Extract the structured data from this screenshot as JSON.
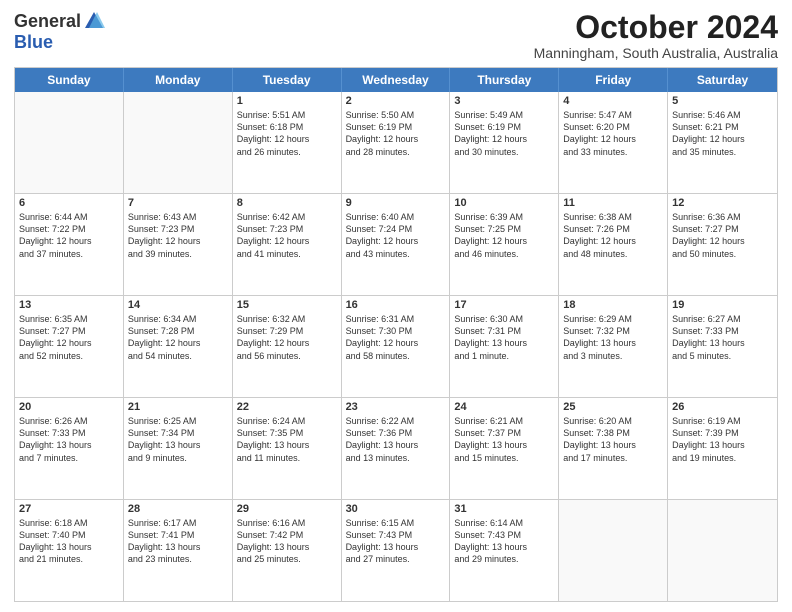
{
  "logo": {
    "general": "General",
    "blue": "Blue"
  },
  "title": "October 2024",
  "subtitle": "Manningham, South Australia, Australia",
  "headers": [
    "Sunday",
    "Monday",
    "Tuesday",
    "Wednesday",
    "Thursday",
    "Friday",
    "Saturday"
  ],
  "weeks": [
    [
      {
        "day": "",
        "text": ""
      },
      {
        "day": "",
        "text": ""
      },
      {
        "day": "1",
        "text": "Sunrise: 5:51 AM\nSunset: 6:18 PM\nDaylight: 12 hours\nand 26 minutes."
      },
      {
        "day": "2",
        "text": "Sunrise: 5:50 AM\nSunset: 6:19 PM\nDaylight: 12 hours\nand 28 minutes."
      },
      {
        "day": "3",
        "text": "Sunrise: 5:49 AM\nSunset: 6:19 PM\nDaylight: 12 hours\nand 30 minutes."
      },
      {
        "day": "4",
        "text": "Sunrise: 5:47 AM\nSunset: 6:20 PM\nDaylight: 12 hours\nand 33 minutes."
      },
      {
        "day": "5",
        "text": "Sunrise: 5:46 AM\nSunset: 6:21 PM\nDaylight: 12 hours\nand 35 minutes."
      }
    ],
    [
      {
        "day": "6",
        "text": "Sunrise: 6:44 AM\nSunset: 7:22 PM\nDaylight: 12 hours\nand 37 minutes."
      },
      {
        "day": "7",
        "text": "Sunrise: 6:43 AM\nSunset: 7:23 PM\nDaylight: 12 hours\nand 39 minutes."
      },
      {
        "day": "8",
        "text": "Sunrise: 6:42 AM\nSunset: 7:23 PM\nDaylight: 12 hours\nand 41 minutes."
      },
      {
        "day": "9",
        "text": "Sunrise: 6:40 AM\nSunset: 7:24 PM\nDaylight: 12 hours\nand 43 minutes."
      },
      {
        "day": "10",
        "text": "Sunrise: 6:39 AM\nSunset: 7:25 PM\nDaylight: 12 hours\nand 46 minutes."
      },
      {
        "day": "11",
        "text": "Sunrise: 6:38 AM\nSunset: 7:26 PM\nDaylight: 12 hours\nand 48 minutes."
      },
      {
        "day": "12",
        "text": "Sunrise: 6:36 AM\nSunset: 7:27 PM\nDaylight: 12 hours\nand 50 minutes."
      }
    ],
    [
      {
        "day": "13",
        "text": "Sunrise: 6:35 AM\nSunset: 7:27 PM\nDaylight: 12 hours\nand 52 minutes."
      },
      {
        "day": "14",
        "text": "Sunrise: 6:34 AM\nSunset: 7:28 PM\nDaylight: 12 hours\nand 54 minutes."
      },
      {
        "day": "15",
        "text": "Sunrise: 6:32 AM\nSunset: 7:29 PM\nDaylight: 12 hours\nand 56 minutes."
      },
      {
        "day": "16",
        "text": "Sunrise: 6:31 AM\nSunset: 7:30 PM\nDaylight: 12 hours\nand 58 minutes."
      },
      {
        "day": "17",
        "text": "Sunrise: 6:30 AM\nSunset: 7:31 PM\nDaylight: 13 hours\nand 1 minute."
      },
      {
        "day": "18",
        "text": "Sunrise: 6:29 AM\nSunset: 7:32 PM\nDaylight: 13 hours\nand 3 minutes."
      },
      {
        "day": "19",
        "text": "Sunrise: 6:27 AM\nSunset: 7:33 PM\nDaylight: 13 hours\nand 5 minutes."
      }
    ],
    [
      {
        "day": "20",
        "text": "Sunrise: 6:26 AM\nSunset: 7:33 PM\nDaylight: 13 hours\nand 7 minutes."
      },
      {
        "day": "21",
        "text": "Sunrise: 6:25 AM\nSunset: 7:34 PM\nDaylight: 13 hours\nand 9 minutes."
      },
      {
        "day": "22",
        "text": "Sunrise: 6:24 AM\nSunset: 7:35 PM\nDaylight: 13 hours\nand 11 minutes."
      },
      {
        "day": "23",
        "text": "Sunrise: 6:22 AM\nSunset: 7:36 PM\nDaylight: 13 hours\nand 13 minutes."
      },
      {
        "day": "24",
        "text": "Sunrise: 6:21 AM\nSunset: 7:37 PM\nDaylight: 13 hours\nand 15 minutes."
      },
      {
        "day": "25",
        "text": "Sunrise: 6:20 AM\nSunset: 7:38 PM\nDaylight: 13 hours\nand 17 minutes."
      },
      {
        "day": "26",
        "text": "Sunrise: 6:19 AM\nSunset: 7:39 PM\nDaylight: 13 hours\nand 19 minutes."
      }
    ],
    [
      {
        "day": "27",
        "text": "Sunrise: 6:18 AM\nSunset: 7:40 PM\nDaylight: 13 hours\nand 21 minutes."
      },
      {
        "day": "28",
        "text": "Sunrise: 6:17 AM\nSunset: 7:41 PM\nDaylight: 13 hours\nand 23 minutes."
      },
      {
        "day": "29",
        "text": "Sunrise: 6:16 AM\nSunset: 7:42 PM\nDaylight: 13 hours\nand 25 minutes."
      },
      {
        "day": "30",
        "text": "Sunrise: 6:15 AM\nSunset: 7:43 PM\nDaylight: 13 hours\nand 27 minutes."
      },
      {
        "day": "31",
        "text": "Sunrise: 6:14 AM\nSunset: 7:43 PM\nDaylight: 13 hours\nand 29 minutes."
      },
      {
        "day": "",
        "text": ""
      },
      {
        "day": "",
        "text": ""
      }
    ]
  ]
}
